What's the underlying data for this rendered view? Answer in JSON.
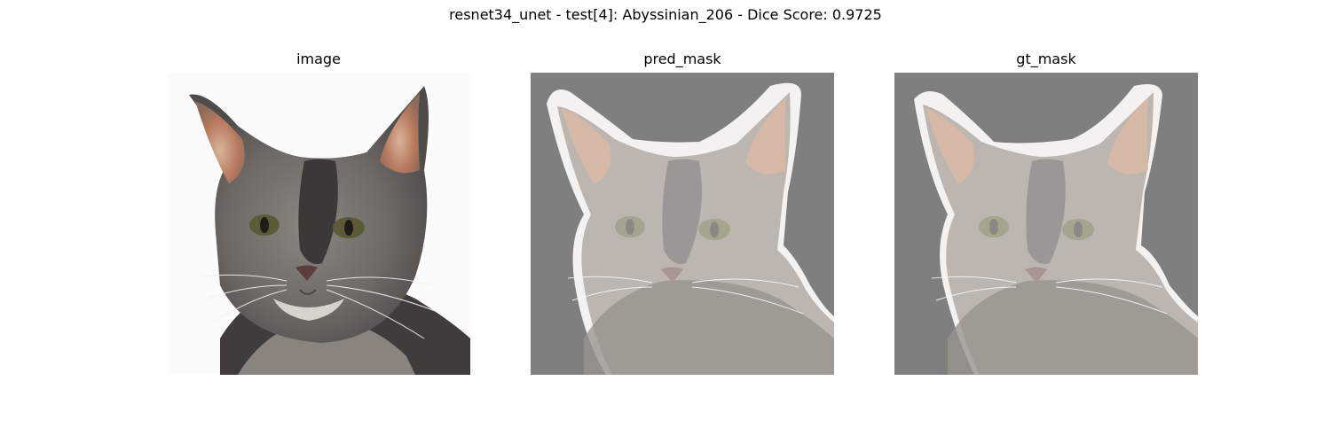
{
  "figure": {
    "suptitle": "resnet34_unet - test[4]: Abyssinian_206 - Dice Score: 0.9725"
  },
  "panels": [
    {
      "title": "image"
    },
    {
      "title": "pred_mask"
    },
    {
      "title": "gt_mask"
    }
  ],
  "colors": {
    "background": "#ffffff",
    "mask_background": "#7f7f7f",
    "photo_background": "#fbfbfb",
    "cat_fur": "#7d7772",
    "cat_dark": "#4a4644",
    "ear_inner": "#c08a6a",
    "eye": "#5d5a3a"
  }
}
